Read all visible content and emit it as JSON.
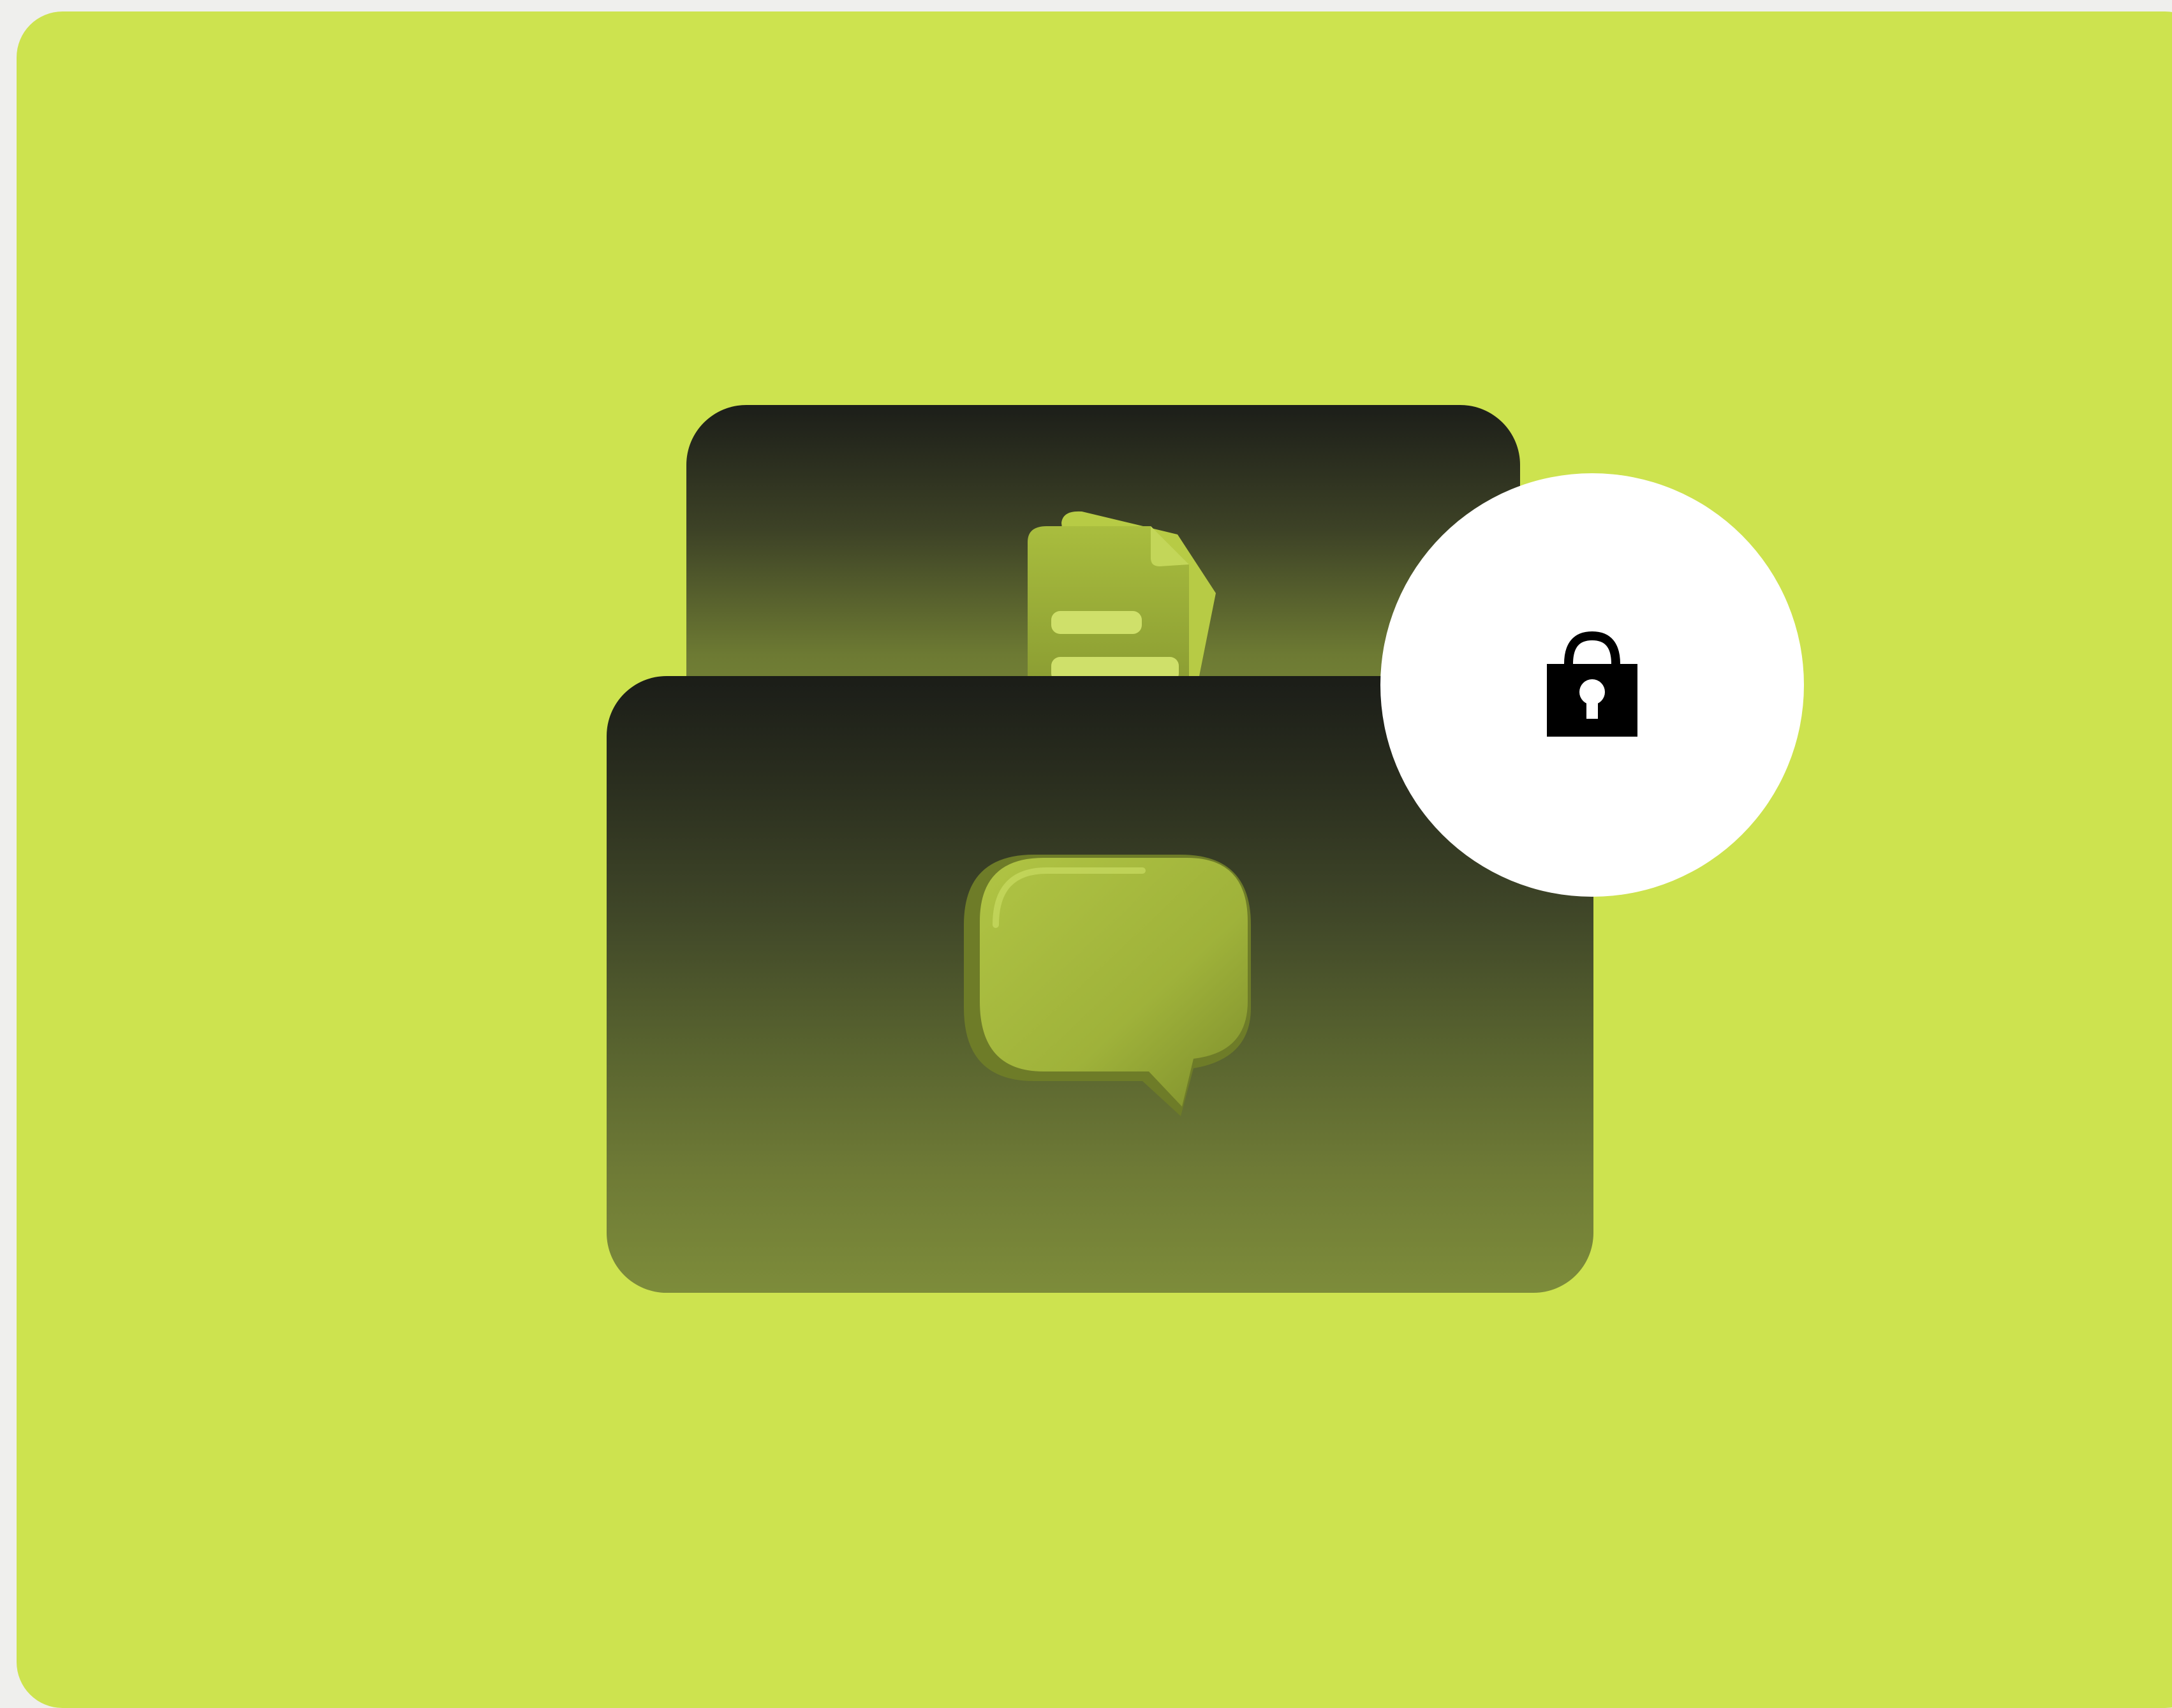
{
  "colors": {
    "background": "#cde34f",
    "card_dark": "#1c1e19",
    "card_olive": "#7d8c3a",
    "art_green": "#9fb23a",
    "badge": "#ffffff",
    "lock": "#000000"
  },
  "icons": {
    "back_card": "document-icon",
    "front_card": "chat-bubble-icon",
    "badge": "lock-icon"
  }
}
